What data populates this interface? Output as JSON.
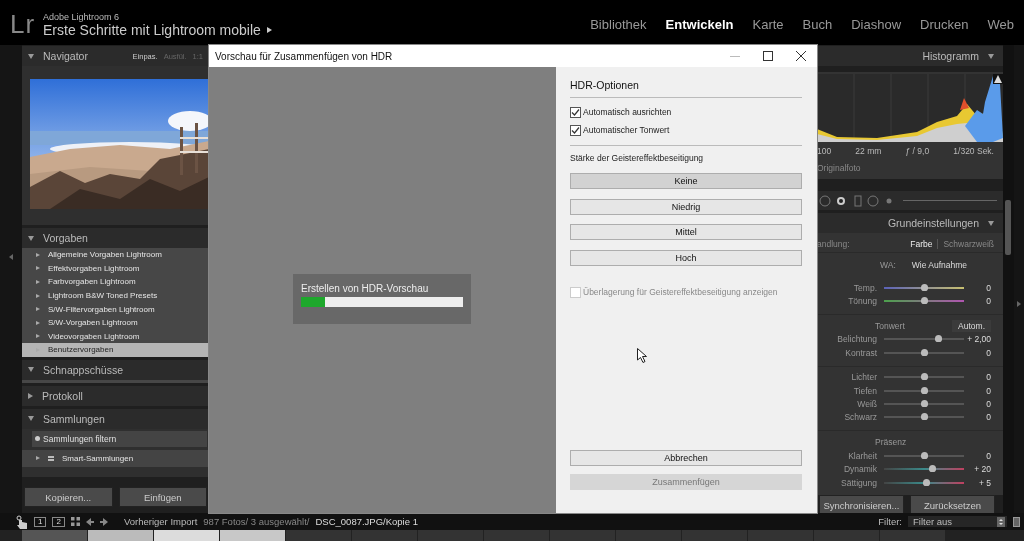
{
  "app": {
    "logo": "Lr",
    "product": "Adobe Lightroom 6",
    "identity_plate": "Erste Schritte mit Lightroom mobile"
  },
  "modules": [
    {
      "label": "Bibliothek",
      "selected": false
    },
    {
      "label": "Entwickeln",
      "selected": true
    },
    {
      "label": "Karte",
      "selected": false
    },
    {
      "label": "Buch",
      "selected": false
    },
    {
      "label": "Diashow",
      "selected": false
    },
    {
      "label": "Drucken",
      "selected": false
    },
    {
      "label": "Web",
      "selected": false
    }
  ],
  "left_panel": {
    "navigator": {
      "title": "Navigator",
      "expanded": true,
      "zoom_options": [
        {
          "label": "Einpas.",
          "selected": true
        },
        {
          "label": "Ausfül.",
          "selected": false
        },
        {
          "label": "1:1",
          "selected": false
        }
      ]
    },
    "sections": [
      {
        "title": "Vorgaben",
        "expanded": true,
        "items": [
          {
            "label": "Allgemeine Vorgaben Lightroom",
            "selected": false
          },
          {
            "label": "Effektvorgaben Lightroom",
            "selected": false
          },
          {
            "label": "Farbvorgaben Lightroom",
            "selected": false
          },
          {
            "label": "Lightroom B&W Toned Presets",
            "selected": false
          },
          {
            "label": "S/W-Filtervorgaben Lightroom",
            "selected": false
          },
          {
            "label": "S/W-Vorgaben Lightroom",
            "selected": false
          },
          {
            "label": "Videovorgaben Lightroom",
            "selected": false
          },
          {
            "label": "Benutzervorgaben",
            "selected": true
          }
        ]
      },
      {
        "title": "Schnappschüsse",
        "expanded": true
      },
      {
        "title": "Protokoll",
        "expanded": false
      },
      {
        "title": "Sammlungen",
        "expanded": true,
        "filter": "Sammlungen filtern",
        "items": [
          {
            "label": "Smart-Sammlungen",
            "selected": false
          }
        ]
      }
    ],
    "buttons": [
      "Kopieren...",
      "Einfügen"
    ]
  },
  "right_panel": {
    "histogram": {
      "title": "Histogramm",
      "exif": [
        "100",
        "22 mm",
        "ƒ / 9,0",
        "1/320 Sek."
      ],
      "photo_info": "Originalfoto"
    },
    "basic": {
      "title": "Grundeinstellungen",
      "treatment_label": "andlung:",
      "treatment_options": [
        {
          "label": "Farbe",
          "selected": true
        },
        {
          "label": "Schwarzweiß",
          "selected": false
        }
      ],
      "wb_label": "WA:",
      "wb_value": "Wie Aufnahme",
      "groups": [
        {
          "sliders": [
            {
              "label": "Temp.",
              "kind": "temp",
              "level": 0.5,
              "reading": "0"
            },
            {
              "label": "Tönung",
              "kind": "tint",
              "level": 0.5,
              "reading": "0"
            }
          ]
        },
        {
          "title": "Tonwert",
          "button": "Autom.",
          "sliders": [
            {
              "label": "Belichtung",
              "kind": "plain",
              "level": 0.68,
              "reading": "+ 2,00"
            },
            {
              "label": "Kontrast",
              "kind": "plain",
              "level": 0.5,
              "reading": "0"
            }
          ]
        },
        {
          "sliders": [
            {
              "label": "Lichter",
              "kind": "plain",
              "level": 0.5,
              "reading": "0"
            },
            {
              "label": "Tiefen",
              "kind": "plain",
              "level": 0.5,
              "reading": "0"
            },
            {
              "label": "Weiß",
              "kind": "plain",
              "level": 0.5,
              "reading": "0"
            },
            {
              "label": "Schwarz",
              "kind": "plain",
              "level": 0.5,
              "reading": "0"
            }
          ]
        },
        {
          "title": "Präsenz",
          "sliders": [
            {
              "label": "Klarheit",
              "kind": "plain",
              "level": 0.5,
              "reading": "0"
            },
            {
              "label": "Dynamik",
              "kind": "color",
              "level": 0.6,
              "reading": "+ 20"
            },
            {
              "label": "Sättigung",
              "kind": "color",
              "level": 0.52,
              "reading": "+ 5"
            }
          ]
        }
      ]
    },
    "buttons": [
      "Synchronisieren...",
      "Zurücksetzen"
    ]
  },
  "toolbar": {
    "view_buttons": [
      "1",
      "2"
    ],
    "source": "Vorheriger Import",
    "info": "987 Fotos/ 3 ausgewählt/",
    "file": "DSC_0087.JPG/Kopie 1",
    "filter_label": "Filter:",
    "filter_value": "Filter aus"
  },
  "dialog": {
    "title": "Vorschau für Zusammenfügen von HDR",
    "progress": {
      "status": "Erstellen von HDR-Vorschau",
      "level": 0.15
    },
    "options": {
      "title": "HDR-Optionen",
      "checkboxes": [
        {
          "label": "Automatisch ausrichten",
          "checked": true,
          "disabled": false
        },
        {
          "label": "Automatischer Tonwert",
          "checked": true,
          "disabled": false
        }
      ],
      "deghost_label": "Stärke der Geistereffektbeseitigung",
      "deghost_levels": [
        {
          "label": "Keine",
          "selected": true
        },
        {
          "label": "Niedrig",
          "selected": false
        },
        {
          "label": "Mittel",
          "selected": false
        },
        {
          "label": "Hoch",
          "selected": false
        }
      ],
      "overlay": {
        "label": "Überlagerung für Geistereffektbeseitigung anzeigen",
        "checked": false,
        "disabled": true
      }
    },
    "buttons": [
      {
        "label": "Abbrechen",
        "disabled": false
      },
      {
        "label": "Zusammenfügen",
        "disabled": true
      }
    ]
  }
}
